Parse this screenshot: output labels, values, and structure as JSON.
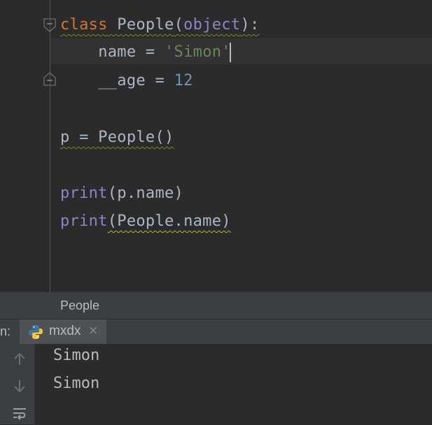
{
  "editor": {
    "lines": {
      "l1": {
        "kw": "class",
        "name": " People",
        "lparen": "(",
        "base": "object",
        "rparen": ")",
        "colon": ":"
      },
      "l2": {
        "indent": "    ",
        "lhs": "name = ",
        "value": "'Simon'"
      },
      "l3": {
        "indent": "    ",
        "lhs": "__age = ",
        "value": "12"
      },
      "l5": {
        "text": "p = People()"
      },
      "l7": {
        "fn": "print",
        "args": "(p.name)"
      },
      "l8": {
        "fn": "print",
        "args": "(People.name)"
      }
    }
  },
  "breadcrumb": {
    "label": "People"
  },
  "run_panel": {
    "label": "n:",
    "tab": {
      "label": "mxdx",
      "close": "×"
    }
  },
  "console": {
    "lines": [
      "Simon",
      "Simon"
    ]
  },
  "colors": {
    "background": "#2b2b2b",
    "keyword": "#cc7832",
    "builtin": "#8888c6",
    "string": "#6a8759",
    "number": "#6897bb",
    "text": "#a9b7c6"
  }
}
